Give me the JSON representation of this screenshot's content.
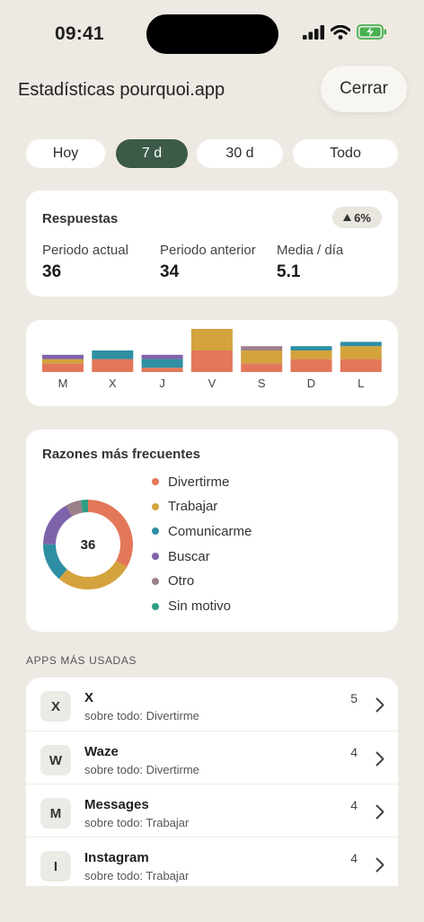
{
  "status_bar": {
    "time": "09:41"
  },
  "header": {
    "title": "Estadísticas pourquoi.app",
    "close_label": "Cerrar"
  },
  "tabs": [
    {
      "label": "Hoy",
      "active": false
    },
    {
      "label": "7 d",
      "active": true
    },
    {
      "label": "30 d",
      "active": false
    },
    {
      "label": "Todo",
      "active": false
    }
  ],
  "responses": {
    "title": "Respuestas",
    "trend": "6%",
    "metrics": [
      {
        "label": "Periodo actual",
        "value": "36"
      },
      {
        "label": "Periodo anterior",
        "value": "34"
      },
      {
        "label": "Media / día",
        "value": "5.1"
      }
    ]
  },
  "colors": {
    "divertirme": "#e2775a",
    "trabajar": "#d4a33d",
    "comunicarme": "#2e8fa3",
    "buscar": "#7f63aa",
    "otro": "#9b7f8b",
    "sin_motivo": "#2f9e86",
    "accent": "#3c5a48"
  },
  "chart_data": [
    {
      "type": "bar",
      "stacked": true,
      "categories": [
        "M",
        "X",
        "J",
        "V",
        "S",
        "D",
        "L"
      ],
      "series": [
        {
          "name": "Divertirme",
          "color": "#e2775a",
          "values": [
            2,
            3,
            1,
            5,
            2,
            3,
            3
          ]
        },
        {
          "name": "Trabajar",
          "color": "#d4a33d",
          "values": [
            1,
            0,
            0,
            5,
            3,
            2,
            3
          ]
        },
        {
          "name": "Comunicarme",
          "color": "#2e8fa3",
          "values": [
            0,
            2,
            2,
            0,
            0,
            1,
            1
          ]
        },
        {
          "name": "Buscar",
          "color": "#7f63aa",
          "values": [
            1,
            0,
            1,
            0,
            0,
            0,
            0
          ]
        },
        {
          "name": "Otro",
          "color": "#9b7f8b",
          "values": [
            0,
            0,
            0,
            0,
            1,
            0,
            0
          ]
        }
      ],
      "grid": false
    },
    {
      "type": "pie",
      "center_label": "36",
      "categories": [
        "Divertirme",
        "Trabajar",
        "Comunicarme",
        "Buscar",
        "Otro",
        "Sin motivo"
      ],
      "values": [
        12,
        10,
        5,
        6,
        2,
        1
      ],
      "colors": [
        "#e2775a",
        "#d4a33d",
        "#2e8fa3",
        "#7f63aa",
        "#9b7f8b",
        "#2f9e86"
      ]
    }
  ],
  "reasons": {
    "title": "Razones más frecuentes",
    "legend": [
      {
        "label": "Divertirme",
        "color": "#e2775a"
      },
      {
        "label": "Trabajar",
        "color": "#d4a33d"
      },
      {
        "label": "Comunicarme",
        "color": "#2e8fa3"
      },
      {
        "label": "Buscar",
        "color": "#7f63aa"
      },
      {
        "label": "Otro",
        "color": "#9b7f8b"
      },
      {
        "label": "Sin motivo",
        "color": "#2f9e86"
      }
    ]
  },
  "apps": {
    "section_label": "APPS MÁS USADAS",
    "items": [
      {
        "initial": "X",
        "name": "X",
        "subtitle": "sobre todo: Divertirme",
        "count": "5"
      },
      {
        "initial": "W",
        "name": "Waze",
        "subtitle": "sobre todo: Divertirme",
        "count": "4"
      },
      {
        "initial": "M",
        "name": "Messages",
        "subtitle": "sobre todo: Trabajar",
        "count": "4"
      },
      {
        "initial": "I",
        "name": "Instagram",
        "subtitle": "sobre todo: Trabajar",
        "count": "4"
      }
    ]
  }
}
